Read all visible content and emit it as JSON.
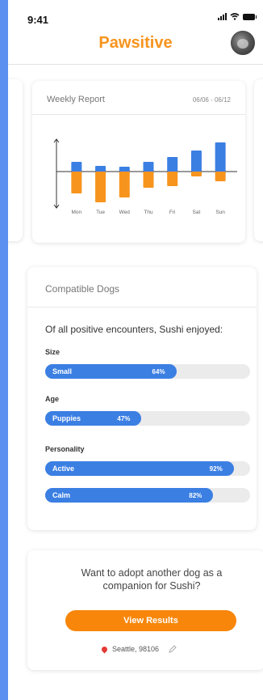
{
  "status_bar": {
    "time": "9:41"
  },
  "header": {
    "brand_part1": "Paw",
    "brand_part2": "sitive"
  },
  "weekly_report": {
    "title": "Weekly Report",
    "date_range": "06/06 - 06/12"
  },
  "chart_data": {
    "type": "bar",
    "categories": [
      "Mon",
      "Tue",
      "Wed",
      "Thu",
      "Fri",
      "Sat",
      "Sun"
    ],
    "series": [
      {
        "values": [
          12,
          7,
          6,
          12,
          18,
          26,
          36
        ],
        "color": "#3b7fe3"
      },
      {
        "values": [
          -27,
          -38,
          -32,
          -20,
          -18,
          -6,
          -12
        ],
        "color": "#f7941d"
      }
    ],
    "title": "Weekly Report",
    "xlabel": "",
    "ylabel": "",
    "ylim": [
      -45,
      40
    ],
    "grid": false
  },
  "compatible": {
    "title": "Compatible Dogs",
    "subtitle": "Of all positive encounters, Sushi enjoyed:",
    "groups": [
      {
        "label": "Size",
        "bars": [
          {
            "label": "Small",
            "value": 64,
            "pct": "64%"
          }
        ]
      },
      {
        "label": "Age",
        "bars": [
          {
            "label": "Puppies",
            "value": 47,
            "pct": "47%"
          }
        ]
      },
      {
        "label": "Personality",
        "bars": [
          {
            "label": "Active",
            "value": 92,
            "pct": "92%"
          },
          {
            "label": "Calm",
            "value": 82,
            "pct": "82%"
          }
        ]
      }
    ]
  },
  "adopt": {
    "prompt": "Want to adopt another dog as a companion for Sushi?",
    "button": "View Results",
    "location": "Seattle, 98106"
  },
  "colors": {
    "accent": "#f7941d",
    "blue": "#3b7fe3",
    "frame": "#5b8ff0"
  }
}
